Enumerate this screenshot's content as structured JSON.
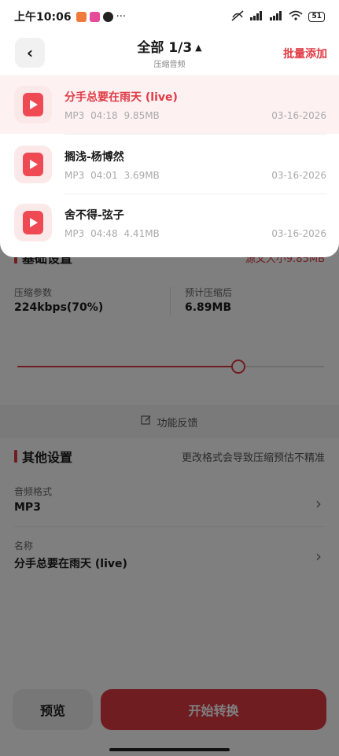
{
  "status_bar": {
    "time": "上午10:06",
    "battery": "51"
  },
  "background": {
    "basic_settings": {
      "title": "基础设置",
      "note": "源文大小9.85MB"
    },
    "compress_label": "压缩参数",
    "compress_value": "224kbps(70%)",
    "estimate_label": "预计压缩后",
    "estimate_value": "6.89MB",
    "slider_fraction": 0.72,
    "feedback": "功能反馈",
    "other_settings": {
      "title": "其他设置",
      "note": "更改格式会导致压缩预估不精准"
    },
    "format_label": "音频格式",
    "format_value": "MP3",
    "name_label": "名称",
    "name_value": "分手总要在雨天 (live)",
    "preview_button": "预览",
    "start_button": "开始转换"
  },
  "sheet": {
    "title": "全部 1/3",
    "subtitle": "压缩音频",
    "batch_add": "批量添加",
    "files": [
      {
        "name": "分手总要在雨天 (live)",
        "format": "MP3",
        "duration": "04:18",
        "size": "9.85MB",
        "date": "03-16-2026",
        "selected": true
      },
      {
        "name": "搁浅-杨博然",
        "format": "MP3",
        "duration": "04:01",
        "size": "3.69MB",
        "date": "03-16-2026",
        "selected": false
      },
      {
        "name": "舍不得-弦子",
        "format": "MP3",
        "duration": "04:48",
        "size": "4.41MB",
        "date": "03-16-2026",
        "selected": false
      }
    ]
  },
  "colors": {
    "accent": "#e03a44"
  },
  "icons": {
    "back": "chevron-left-icon",
    "caret": "caret-up-icon",
    "chevron": "chevron-right-icon",
    "feedback": "edit-icon",
    "file": "audio-file-icon"
  }
}
